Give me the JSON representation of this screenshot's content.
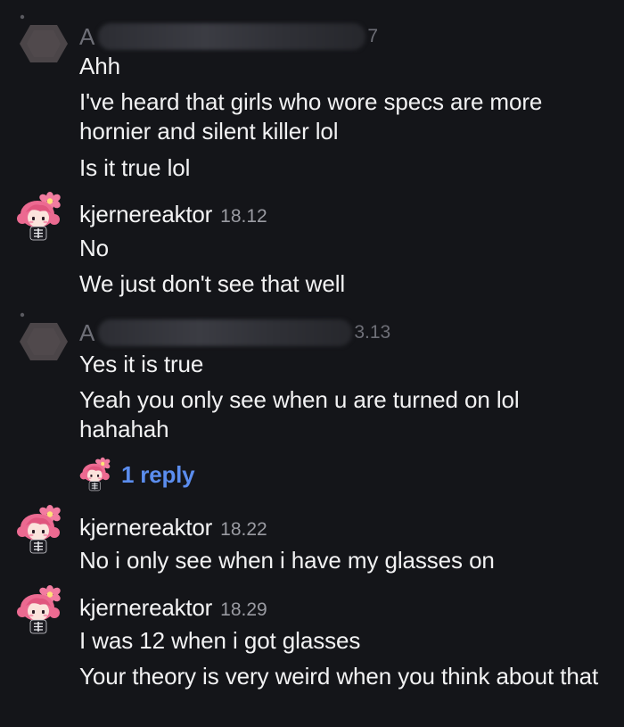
{
  "messages": [
    {
      "author_visible_initial": "A",
      "time_visible_fragment": "7",
      "author_redacted": true,
      "lines": [
        "Ahh",
        "I've heard that girls who wore specs are more hornier and silent killer lol",
        "Is it true lol"
      ]
    },
    {
      "author": "kjernereaktor",
      "time": "18.12",
      "author_redacted": false,
      "lines": [
        "No",
        "We just don't see that well"
      ]
    },
    {
      "author_visible_initial": "A",
      "time_visible_fragment": "3.13",
      "author_redacted": true,
      "lines": [
        "Yes it is true",
        "Yeah you only see when u are turned on lol hahahah"
      ]
    },
    {
      "author": "kjernereaktor",
      "time": "18.22",
      "author_redacted": false,
      "lines": [
        "No i only see when i have my glasses on"
      ]
    },
    {
      "author": "kjernereaktor",
      "time": "18.29",
      "author_redacted": false,
      "lines": [
        "I was 12 when i got glasses",
        "Your theory is very weird when you think about that"
      ]
    }
  ],
  "reply_link": {
    "label": "1 reply",
    "avatar_icon": "anime-avatar-icon"
  },
  "colors": {
    "background": "#141519",
    "text": "#f2f2f3",
    "timestamp": "#9a9ba2",
    "link": "#5b8dee",
    "avatar_hair": "#f06a93",
    "redacted_avatar": "#4b4548"
  }
}
